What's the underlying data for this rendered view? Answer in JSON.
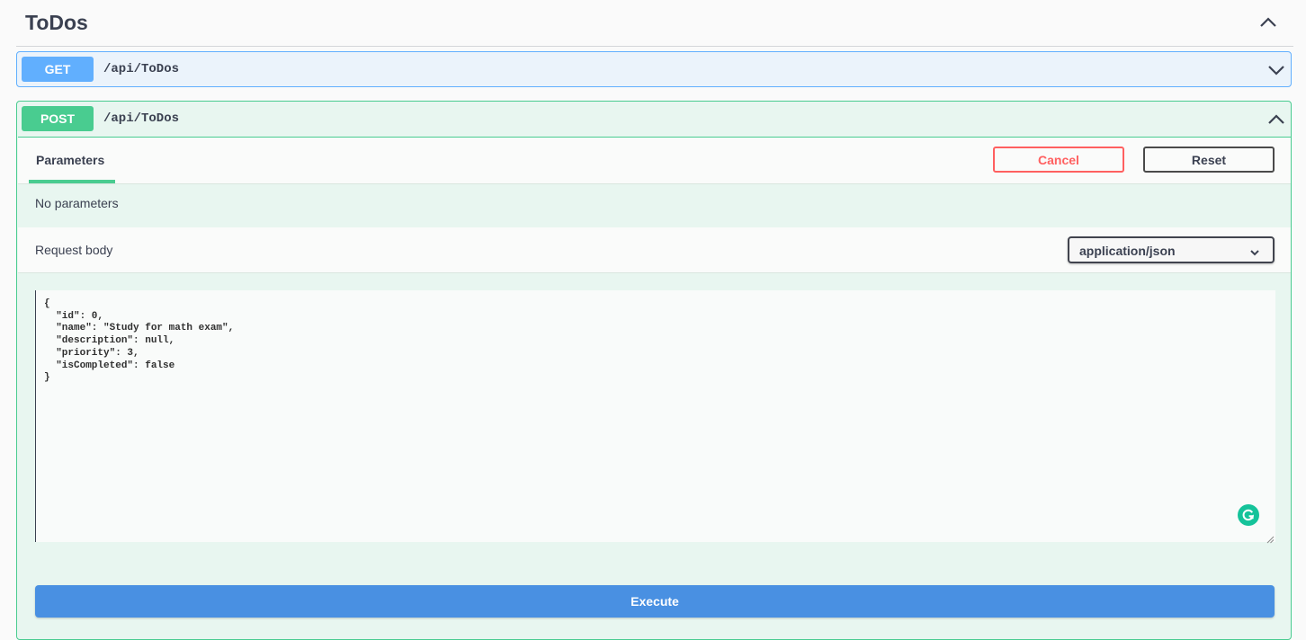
{
  "section": {
    "title": "ToDos"
  },
  "get_op": {
    "method": "GET",
    "path": "/api/ToDos"
  },
  "post_op": {
    "method": "POST",
    "path": "/api/ToDos",
    "tab_label": "Parameters",
    "cancel_label": "Cancel",
    "reset_label": "Reset",
    "no_params_text": "No parameters",
    "request_body_label": "Request body",
    "content_type": "application/json",
    "body": "{\n  \"id\": 0,\n  \"name\": \"Study for math exam\",\n  \"description\": null,\n  \"priority\": 3,\n  \"isCompleted\": false\n}",
    "execute_label": "Execute"
  },
  "icons": {
    "section_toggle": "chevron-up-icon",
    "get_toggle": "chevron-down-icon",
    "post_toggle": "chevron-up-icon",
    "select_arrow": "chevron-down-icon",
    "grammarly": "grammarly-icon",
    "resize": "resize-handle-icon"
  },
  "colors": {
    "get": "#61affe",
    "post": "#49cc90",
    "cancel": "#ff6060",
    "execute": "#4990e2"
  }
}
